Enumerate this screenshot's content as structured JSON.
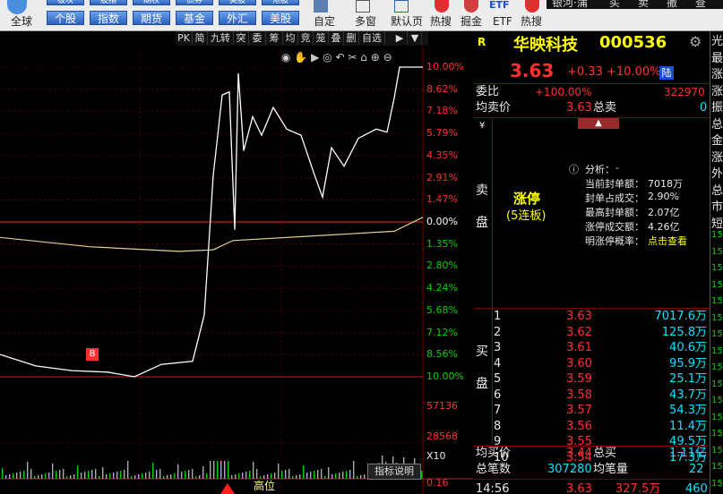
{
  "toolbar": {
    "top_buttons": [
      "板块",
      "股指",
      "期权",
      "债券",
      "美股",
      "港股"
    ],
    "nav_buttons": [
      "个股",
      "指数",
      "期货",
      "基金",
      "外汇",
      "美股"
    ],
    "left_label": "全球",
    "items": [
      "自定",
      "多窗",
      "默认页",
      "热搜",
      "掘金",
      "ETF",
      "热搜"
    ],
    "right_tabs": [
      "银河·蒲",
      "买",
      "卖",
      "撤",
      "查"
    ]
  },
  "chart": {
    "tools": [
      "PK",
      "简",
      "九转",
      "突",
      "委",
      "筹",
      "均",
      "竞",
      "笼",
      "叠",
      "删",
      "自选"
    ],
    "price_pcts": [
      "10.00%",
      "8.62%",
      "7.18%",
      "5.79%",
      "4.35%",
      "2.91%",
      "1.47%",
      "0.00%",
      "1.35%",
      "2.80%",
      "4.24%",
      "5.68%",
      "7.12%",
      "8.56%",
      "10.00%"
    ],
    "vol_labels": [
      "57136",
      "28568",
      "X10"
    ],
    "indicator_btn": "指标说明",
    "bottom_label": "高位",
    "bottom_value": "0.16",
    "b_marker": "B",
    "colors": {
      "up": "#ff3030",
      "down": "#00d000",
      "line": "#ffffff",
      "avg": "#e0d090",
      "grid": "#7a0000"
    }
  },
  "panel": {
    "r_badge": "R",
    "stock_name": "华映科技",
    "stock_code": "000536",
    "price": "3.63",
    "change": "+0.33",
    "change_pct": "+10.00%",
    "market_tag": "陆",
    "weibi_label": "委比",
    "weibi_value": "+100.00%",
    "weibi_num": "322970",
    "avg_sell_label": "均卖价",
    "avg_sell_value": "3.63",
    "total_sell_label": "总卖",
    "total_sell_value": "0",
    "sell_side_label": "卖盘",
    "limit_up": "涨停",
    "limit_up_days": "(5连板)",
    "analysis_label": "分析：",
    "analysis_dash": "-",
    "analysis": [
      {
        "k": "当前封单额：",
        "v": "7018万"
      },
      {
        "k": "封单占成交：",
        "v": "2.90%"
      },
      {
        "k": "最高封单额：",
        "v": "2.07亿"
      },
      {
        "k": "涨停成交额：",
        "v": "4.26亿"
      },
      {
        "k": "明涨停概率：",
        "v": "点击查看"
      }
    ],
    "buy_side_label": "买盘",
    "bids": [
      {
        "lv": "1",
        "p": "3.63",
        "q": "7017.6万"
      },
      {
        "lv": "2",
        "p": "3.62",
        "q": "125.8万"
      },
      {
        "lv": "3",
        "p": "3.61",
        "q": "40.6万"
      },
      {
        "lv": "4",
        "p": "3.60",
        "q": "95.9万"
      },
      {
        "lv": "5",
        "p": "3.59",
        "q": "25.1万"
      },
      {
        "lv": "6",
        "p": "3.58",
        "q": "43.7万"
      },
      {
        "lv": "7",
        "p": "3.57",
        "q": "54.3万"
      },
      {
        "lv": "8",
        "p": "3.56",
        "q": "11.4万"
      },
      {
        "lv": "9",
        "p": "3.55",
        "q": "49.5万"
      },
      {
        "lv": "10",
        "p": "3.54",
        "q": "17.3万"
      }
    ],
    "avg_buy_label": "均买价",
    "avg_buy_value": "3.44",
    "total_buy_label": "总买",
    "total_buy_value": "1.11亿",
    "total_count_label": "总笔数",
    "total_count_value": "307280",
    "avg_vol_label": "均笔量",
    "avg_vol_value": "22",
    "tick_time": "14:56",
    "tick_price": "3.63",
    "tick_vol": "327.5万",
    "tick_extra": "460"
  },
  "edge": {
    "chars": [
      "光",
      "最",
      "涨",
      "涨",
      "振",
      "总",
      "金",
      "涨",
      "外",
      "总",
      "市",
      "短",
      "15",
      "15",
      "15",
      "15",
      "15",
      "15",
      "15",
      "15",
      "15",
      "15",
      "15",
      "15",
      "15",
      "15",
      "15",
      "15"
    ]
  }
}
